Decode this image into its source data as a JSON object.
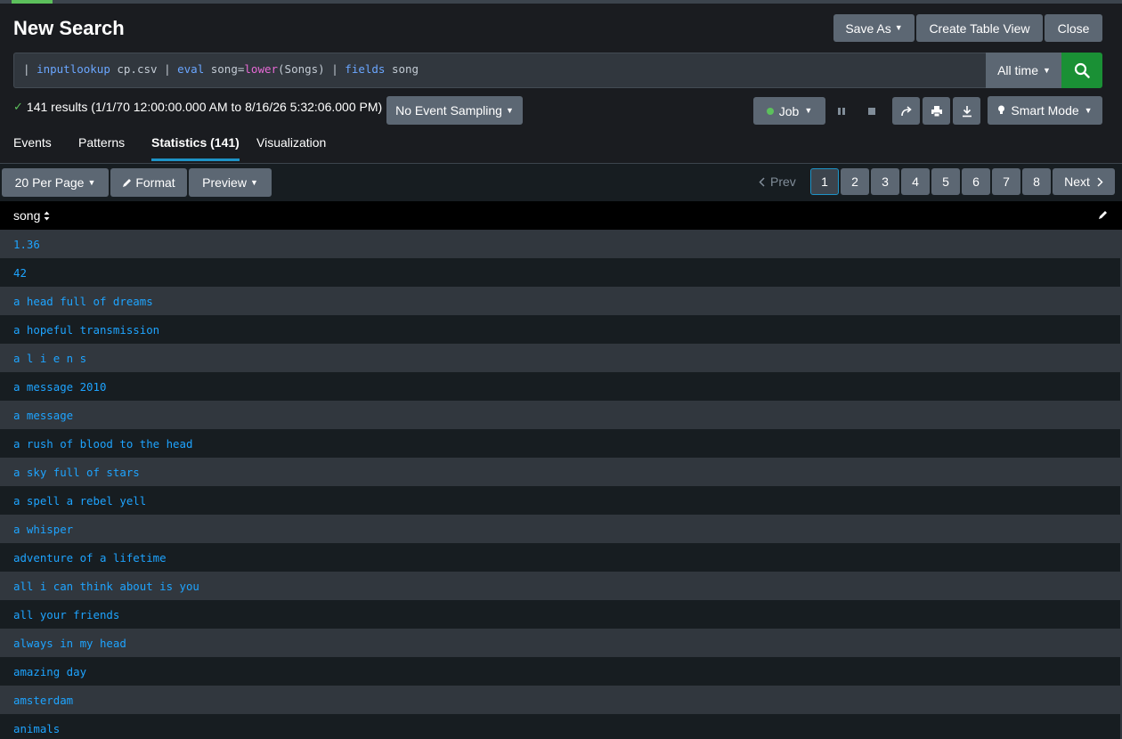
{
  "header": {
    "title": "New Search",
    "save_as": "Save As",
    "create_table_view": "Create Table View",
    "close": "Close"
  },
  "search": {
    "query_parts": {
      "p1": "| ",
      "c1": "inputlookup",
      "a1": " cp.csv | ",
      "c2": "eval",
      "a2": " song=",
      "f1": "lower",
      "a3": "(Songs) | ",
      "c3": "fields",
      "a4": " song"
    },
    "time_range": "All time"
  },
  "status": {
    "results_text": "141 results (1/1/70 12:00:00.000 AM to 8/16/26 5:32:06.000 PM)",
    "sampling": "No Event Sampling",
    "job": "Job",
    "mode": "Smart Mode"
  },
  "tabs": {
    "events": "Events",
    "patterns": "Patterns",
    "statistics": "Statistics (141)",
    "visualization": "Visualization"
  },
  "toolbar": {
    "per_page": "20 Per Page",
    "format": "Format",
    "preview": "Preview",
    "prev": "Prev",
    "next": "Next",
    "pages": [
      "1",
      "2",
      "3",
      "4",
      "5",
      "6",
      "7",
      "8"
    ],
    "current_page": "1"
  },
  "table": {
    "column": "song",
    "rows": [
      "1.36",
      "42",
      "a head full of dreams",
      "a hopeful transmission",
      "a l i e n s",
      "a message 2010",
      "a message",
      "a rush of blood to the head",
      "a sky full of stars",
      "a spell a rebel yell",
      "a whisper",
      "adventure of a lifetime",
      "all i can think about is you",
      "all your friends",
      "always in my head",
      "amazing day",
      "amsterdam",
      "animals"
    ]
  },
  "colors": {
    "accent_green": "#1a9035",
    "link_blue": "#1ea4ff",
    "active_tab": "#1e93c6"
  }
}
